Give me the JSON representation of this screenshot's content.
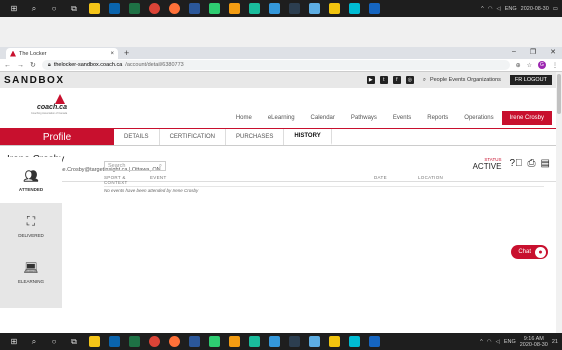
{
  "taskbar": {
    "lang": "ENG",
    "top_date": "2020-08-30",
    "time": "9:16 AM",
    "bottom_date": "2020-08-30",
    "notif": "21"
  },
  "browser": {
    "tab_title": "The Locker",
    "tab_close": "×",
    "new_tab": "+",
    "url_host": "thelocker-sandbox.coach.ca",
    "url_path": "/account/detail/6380773",
    "avatar_letter": "G"
  },
  "site": {
    "banner": "SANDBOX",
    "search_label": "People  Events  Organizations",
    "logout": "LOGOUT",
    "logo_word": "coach.ca",
    "logo_sub": "Coaching Association of Canada",
    "nav": [
      "Home",
      "eLearning",
      "Calendar",
      "Pathways",
      "Events",
      "Reports",
      "Operations"
    ],
    "user_nav": "Irene Crosby"
  },
  "profile": {
    "label": "Profile",
    "tabs": [
      "DETAILS",
      "CERTIFICATION",
      "PURCHASES",
      "HISTORY"
    ],
    "name": "Irene Crosby",
    "meta": "NCCP# 6380773  |  Irene.Crosby@targetinsight.ca  |  Ottawa, ON",
    "status_label": "STATUS",
    "status_value": "ACTIVE"
  },
  "sidebar": [
    {
      "label": "ATTENDED",
      "icon": "group-icon"
    },
    {
      "label": "DELIVERED",
      "icon": "presenter-icon"
    },
    {
      "label": "ELEARNING",
      "icon": "laptop-icon"
    }
  ],
  "history": {
    "search_placeholder": "Search",
    "columns": [
      "SPORT & CONTEXT",
      "EVENT",
      "DATE",
      "LOCATION"
    ],
    "empty": "No events have been attended by Irene Crosby"
  },
  "chat": {
    "label": "Chat"
  },
  "colors": {
    "brand": "#c8102e",
    "dark": "#222222"
  }
}
